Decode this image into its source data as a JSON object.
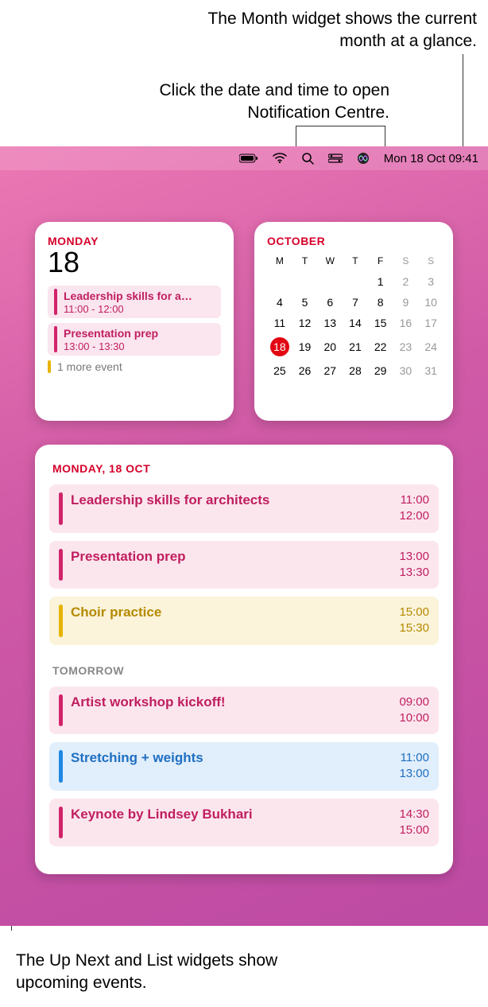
{
  "annotations": {
    "month": "The Month widget shows the current month at a glance.",
    "datetime": "Click the date and time to open Notification Centre.",
    "upnext_list": "The Up Next and List widgets show upcoming events."
  },
  "menubar": {
    "datetime": "Mon 18 Oct  09:41"
  },
  "upnext": {
    "dayname": "MONDAY",
    "daynum": "18",
    "events": [
      {
        "title": "Leadership skills for a…",
        "time": "11:00 - 12:00",
        "color": "pink"
      },
      {
        "title": "Presentation prep",
        "time": "13:00 - 13:30",
        "color": "pink"
      }
    ],
    "more": "1 more event"
  },
  "month": {
    "title": "OCTOBER",
    "headers": [
      "M",
      "T",
      "W",
      "T",
      "F",
      "S",
      "S"
    ],
    "weeks": [
      [
        "",
        "",
        "",
        "",
        "1",
        "2",
        "3"
      ],
      [
        "4",
        "5",
        "6",
        "7",
        "8",
        "9",
        "10"
      ],
      [
        "11",
        "12",
        "13",
        "14",
        "15",
        "16",
        "17"
      ],
      [
        "18",
        "19",
        "20",
        "21",
        "22",
        "23",
        "24"
      ],
      [
        "25",
        "26",
        "27",
        "28",
        "29",
        "30",
        "31"
      ]
    ],
    "today": "18"
  },
  "list": {
    "section1_title": "MONDAY, 18 OCT",
    "section2_title": "TOMORROW",
    "today": [
      {
        "title": "Leadership skills for architects",
        "t1": "11:00",
        "t2": "12:00",
        "color": "pink"
      },
      {
        "title": "Presentation prep",
        "t1": "13:00",
        "t2": "13:30",
        "color": "pink"
      },
      {
        "title": "Choir practice",
        "t1": "15:00",
        "t2": "15:30",
        "color": "yellow"
      }
    ],
    "tomorrow": [
      {
        "title": "Artist workshop kickoff!",
        "t1": "09:00",
        "t2": "10:00",
        "color": "pink"
      },
      {
        "title": "Stretching + weights",
        "t1": "11:00",
        "t2": "13:00",
        "color": "blue"
      },
      {
        "title": "Keynote by Lindsey Bukhari",
        "t1": "14:30",
        "t2": "15:00",
        "color": "pink"
      }
    ]
  }
}
